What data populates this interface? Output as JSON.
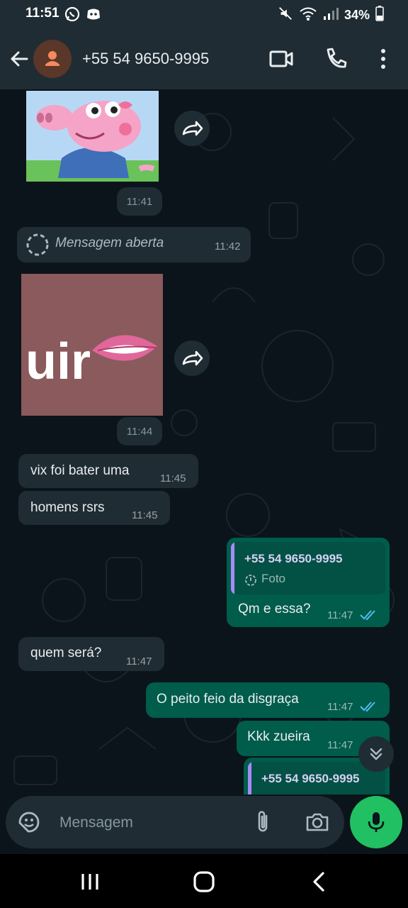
{
  "status_bar": {
    "time": "11:51",
    "battery": "34%"
  },
  "header": {
    "contact_name": "+55 54 9650-9995"
  },
  "messages": {
    "sticker_1": {
      "time": "11:41"
    },
    "view_once": {
      "label": "Mensagem aberta",
      "time": "11:42"
    },
    "sticker_2": {
      "text": "uir",
      "time": "11:44"
    },
    "in_1": {
      "text": "vix foi bater uma",
      "time": "11:45"
    },
    "in_2": {
      "text": "homens rsrs",
      "time": "11:45"
    },
    "out_1": {
      "quote_name": "+55 54 9650-9995",
      "quote_sub": "Foto",
      "text": "Qm e essa?",
      "time": "11:47"
    },
    "in_3": {
      "text": "quem será?",
      "time": "11:47"
    },
    "out_2": {
      "text": "O peito feio da disgraça",
      "time": "11:47"
    },
    "out_3": {
      "text": "Kkk zueira",
      "time": "11:47"
    },
    "out_4": {
      "quote_name": "+55 54 9650-9995"
    }
  },
  "composer": {
    "placeholder": "Mensagem"
  },
  "colors": {
    "outgoing": "#005c4b",
    "incoming": "#1f2c34",
    "accent": "#21c063",
    "read_ticks": "#53bdeb"
  }
}
